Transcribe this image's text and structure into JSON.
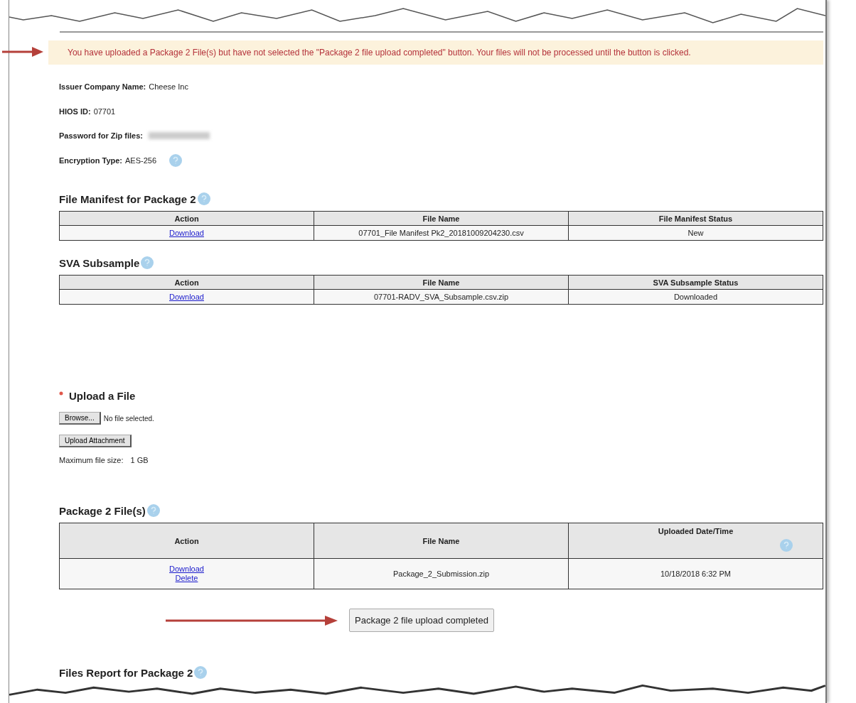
{
  "alert": {
    "text": "You have uploaded a Package 2 File(s) but have not selected the \"Package 2 file upload completed\" button. Your files will not be processed until the button is clicked."
  },
  "details": [
    {
      "kind": "plain",
      "label": "Issuer Company Name:",
      "value": "Cheese Inc"
    },
    {
      "kind": "plain",
      "label": "HIOS ID:",
      "value": "07701"
    },
    {
      "kind": "secret",
      "label": "Password for Zip files:"
    },
    {
      "kind": "info",
      "label": "Encryption Type:",
      "value": "AES-256"
    }
  ],
  "tables": [
    {
      "title": "File Manifest for Package 2",
      "columns": [
        {
          "label": "Action"
        },
        {
          "label": "File Name"
        },
        {
          "label": "File Manifest Status"
        }
      ],
      "rows": [
        {
          "cells": [
            {
              "links": [
                "Download"
              ]
            },
            {
              "text": "07701_File Manifest Pk2_20181009204230.csv"
            },
            {
              "text": "New"
            }
          ]
        }
      ]
    },
    {
      "title": "SVA Subsample",
      "columns": [
        {
          "label": "Action"
        },
        {
          "label": "File Name"
        },
        {
          "label": "SVA Subsample Status"
        }
      ],
      "rows": [
        {
          "cells": [
            {
              "links": [
                "Download"
              ]
            },
            {
              "text": "07701-RADV_SVA_Subsample.csv.zip"
            },
            {
              "text": "Downloaded"
            }
          ]
        }
      ]
    }
  ],
  "upload": {
    "title": "Upload a File",
    "required": true,
    "browse_button": "Browse...",
    "file_status": "No file selected.",
    "upload_button": "Upload Attachment",
    "max_label": "Maximum file size:",
    "max_value": "1 GB"
  },
  "package_files": {
    "title": "Package 2 File(s)",
    "columns": [
      {
        "label": "Action"
      },
      {
        "label": "File Name"
      },
      {
        "label": "Uploaded Date/Time",
        "kind": "info"
      }
    ],
    "rows": [
      {
        "cells": [
          {
            "links": [
              "Download",
              "Delete"
            ]
          },
          {
            "text": "Package_2_Submission.zip"
          },
          {
            "text": "10/18/2018 6:32 PM"
          }
        ]
      }
    ]
  },
  "complete_button": "Package 2 file upload completed",
  "files_report": {
    "title": "Files Report for Package 2"
  }
}
